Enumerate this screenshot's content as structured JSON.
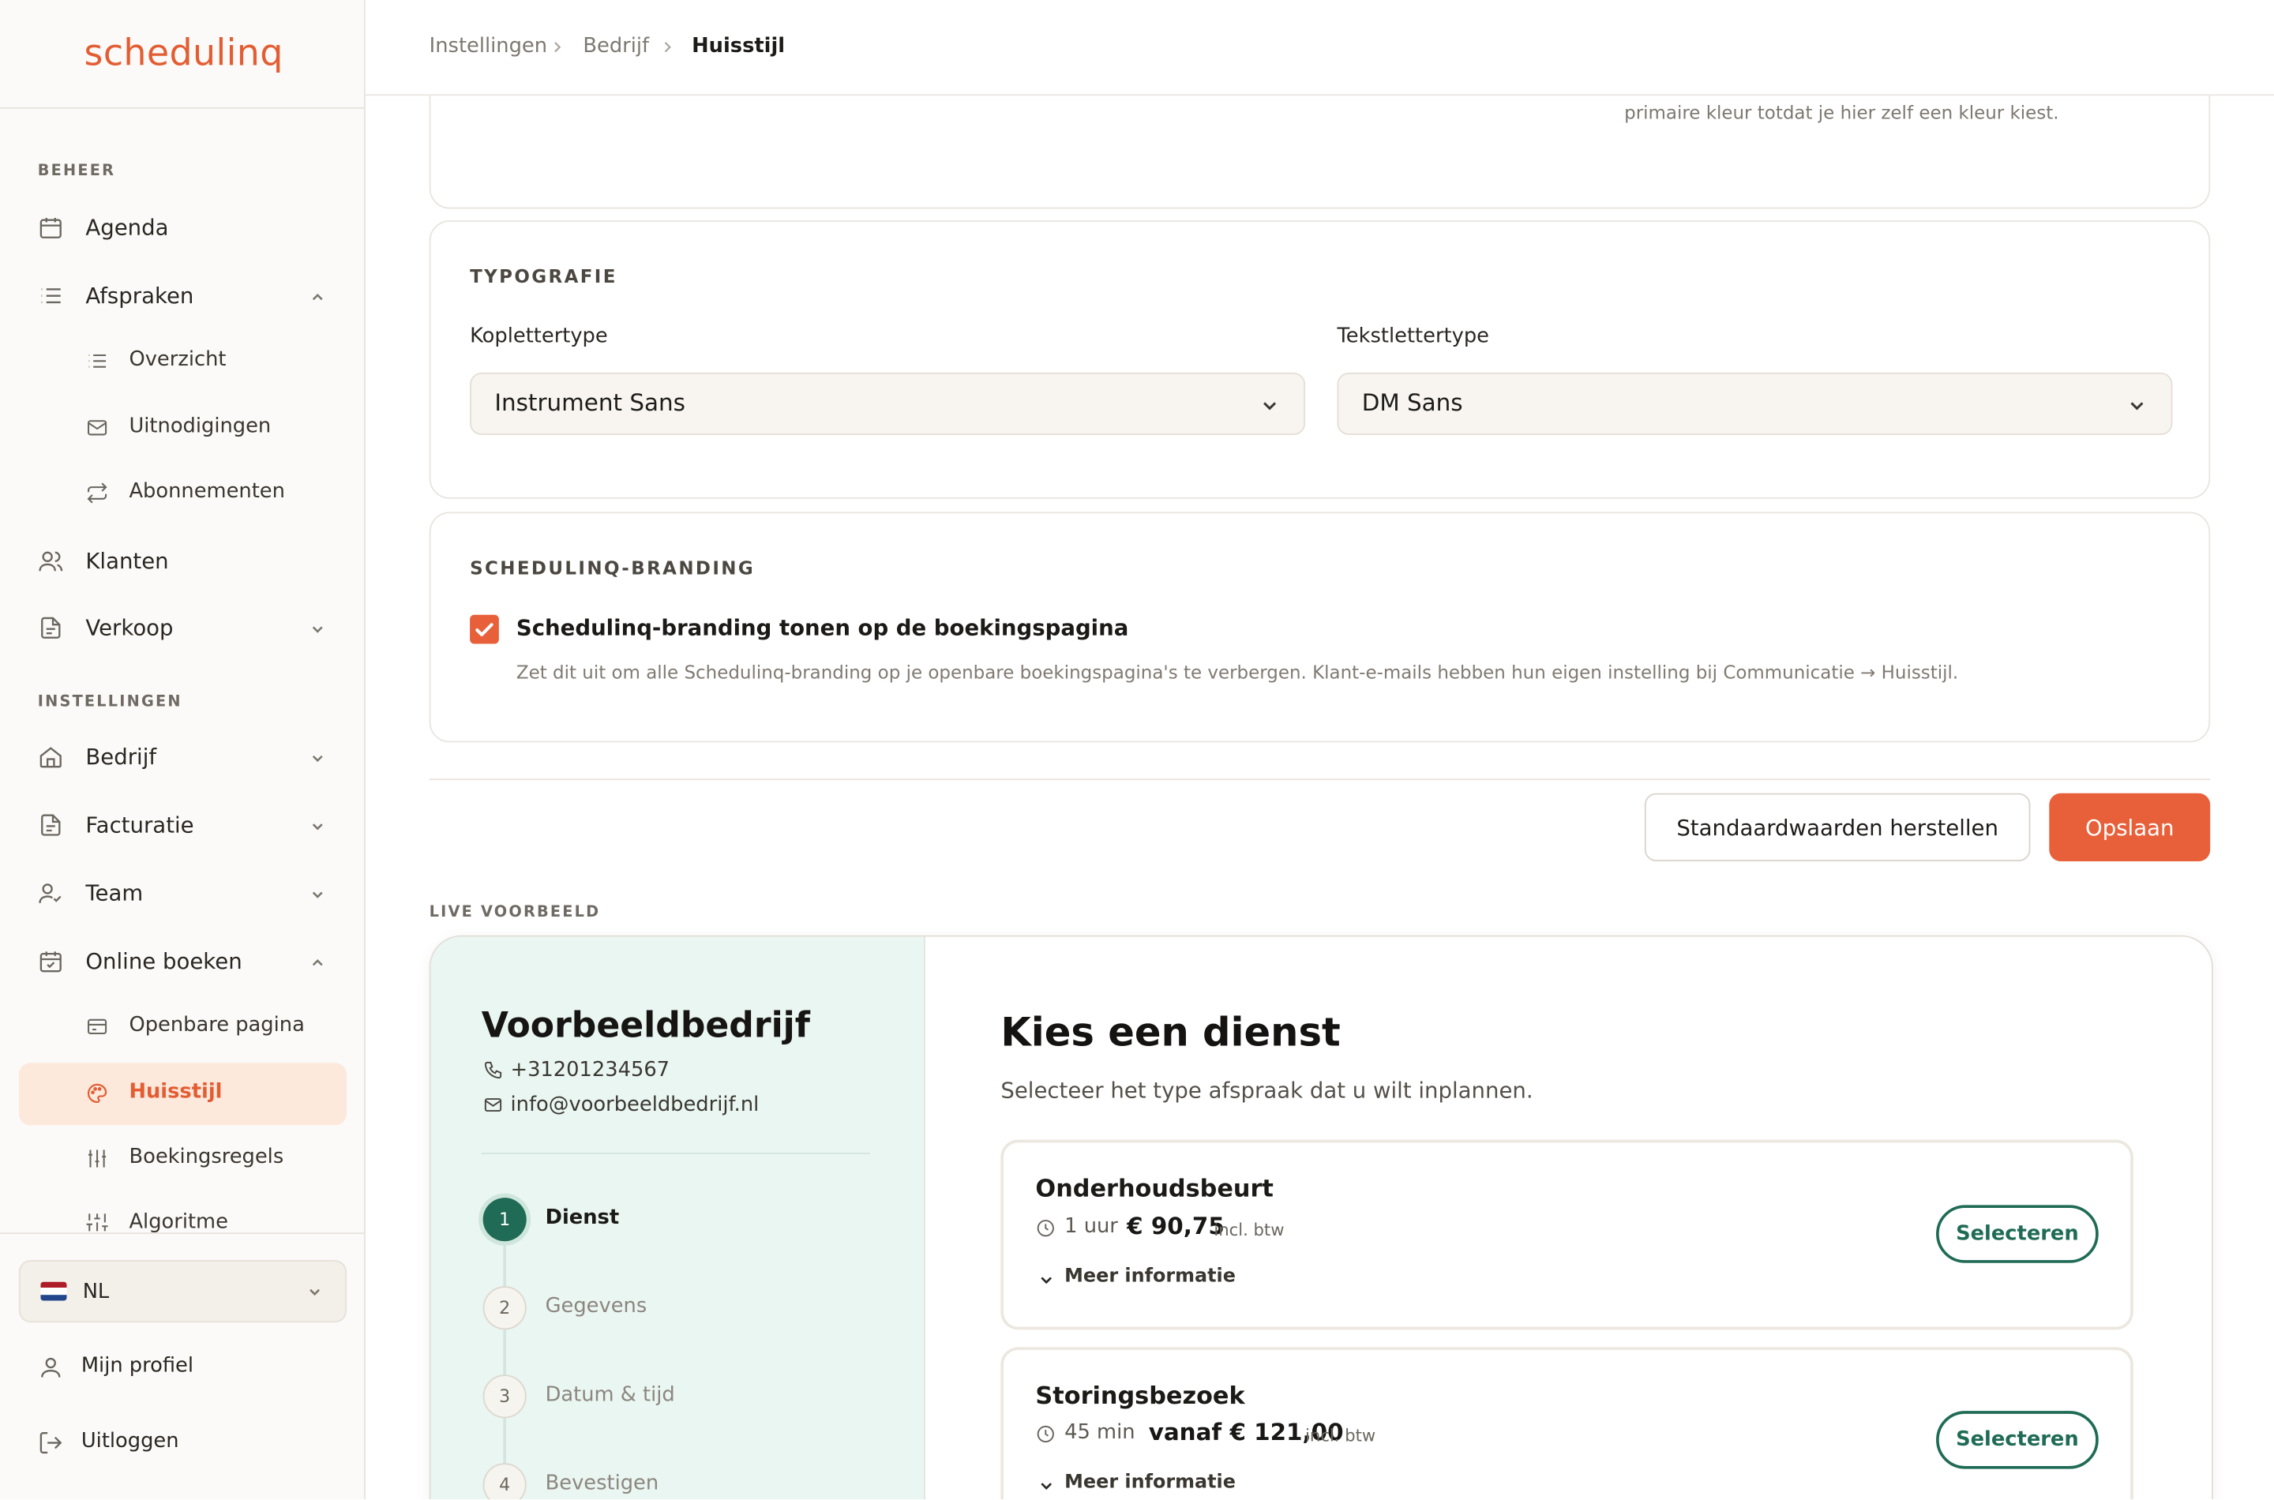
{
  "app": {
    "logo": "schedulinq"
  },
  "sidebar": {
    "section_beheer": "BEHEER",
    "section_instellingen": "INSTELLINGEN",
    "agenda": "Agenda",
    "afspraken": "Afspraken",
    "overzicht": "Overzicht",
    "uitnodigingen": "Uitnodigingen",
    "abonnementen": "Abonnementen",
    "klanten": "Klanten",
    "verkoop": "Verkoop",
    "bedrijf": "Bedrijf",
    "facturatie": "Facturatie",
    "team": "Team",
    "online_boeken": "Online boeken",
    "openbare_pagina": "Openbare pagina",
    "huisstijl": "Huisstijl",
    "boekingsregels": "Boekingsregels",
    "algoritme": "Algoritme",
    "language": "NL",
    "mijn_profiel": "Mijn profiel",
    "uitloggen": "Uitloggen"
  },
  "breadcrumb": {
    "level1": "Instellingen",
    "level2": "Bedrijf",
    "current": "Huisstijl"
  },
  "color_card": {
    "note": "primaire kleur totdat je hier zelf een kleur kiest."
  },
  "typography": {
    "title": "TYPOGRAFIE",
    "heading_label": "Koplettertype",
    "heading_value": "Instrument Sans",
    "body_label": "Tekstlettertype",
    "body_value": "DM Sans"
  },
  "branding": {
    "title": "SCHEDULINQ-BRANDING",
    "checkbox_label": "Schedulinq-branding tonen op de boekingspagina",
    "checked": true,
    "help": "Zet dit uit om alle Schedulinq-branding op je openbare boekingspagina's te verbergen. Klant-e-mails hebben hun eigen instelling bij Communicatie → Huisstijl."
  },
  "actions": {
    "reset": "Standaardwaarden herstellen",
    "save": "Opslaan"
  },
  "preview": {
    "label": "LIVE VOORBEELD",
    "company": "Voorbeeldbedrijf",
    "phone": "+31201234567",
    "email": "info@voorbeeldbedrijf.nl",
    "steps": [
      {
        "num": "1",
        "label": "Dienst"
      },
      {
        "num": "2",
        "label": "Gegevens"
      },
      {
        "num": "3",
        "label": "Datum & tijd"
      },
      {
        "num": "4",
        "label": "Bevestigen"
      }
    ],
    "heading": "Kies een dienst",
    "subheading": "Selecteer het type afspraak dat u wilt inplannen.",
    "services": [
      {
        "name": "Onderhoudsbeurt",
        "duration": "1 uur",
        "price": "€ 90,75",
        "tax": "incl. btw",
        "more": "Meer informatie",
        "select": "Selecteren"
      },
      {
        "name": "Storingsbezoek",
        "duration": "45 min",
        "price": "vanaf € 121,00",
        "tax": "incl. btw",
        "more": "Meer informatie",
        "select": "Selecteren"
      }
    ]
  },
  "colors": {
    "brand_orange": "#e8603a",
    "preview_green": "#1f6b55",
    "preview_mint": "#eaf6f2"
  }
}
